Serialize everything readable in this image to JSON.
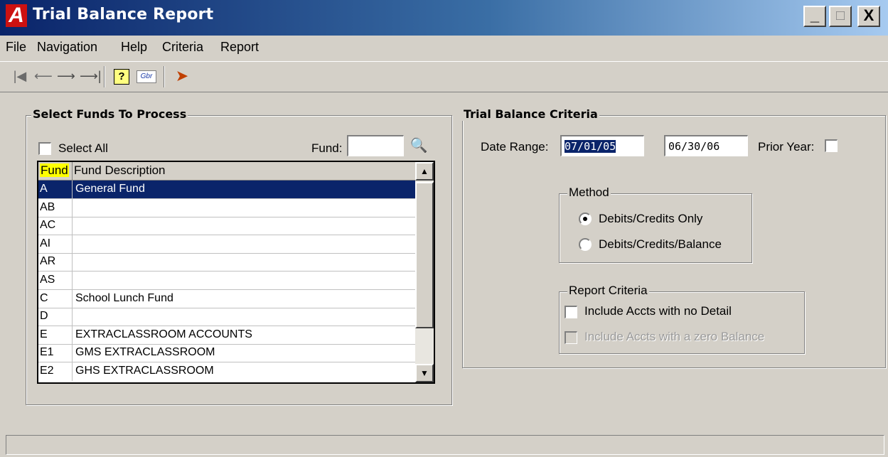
{
  "window": {
    "logo": "A",
    "title": "Trial Balance Report",
    "minimize": "_",
    "maximize": "□",
    "close": "X"
  },
  "menu": [
    "File",
    "Navigation",
    "Help",
    "Criteria",
    "Report"
  ],
  "toolbar": {
    "icons": [
      "first-record-icon",
      "previous-record-icon",
      "next-record-icon",
      "last-record-icon",
      "help-icon",
      "globe-icon",
      "run-icon"
    ]
  },
  "funds_panel": {
    "title": "Select Funds To Process",
    "select_all_label": "Select All",
    "fund_label": "Fund:",
    "fund_value": "",
    "columns": [
      "Fund",
      "Fund Description"
    ],
    "rows": [
      {
        "fund": "A",
        "description": "General Fund",
        "selected": true
      },
      {
        "fund": "AB",
        "description": ""
      },
      {
        "fund": "AC",
        "description": ""
      },
      {
        "fund": "AI",
        "description": ""
      },
      {
        "fund": "AR",
        "description": ""
      },
      {
        "fund": "AS",
        "description": ""
      },
      {
        "fund": "C",
        "description": "School Lunch Fund"
      },
      {
        "fund": "D",
        "description": ""
      },
      {
        "fund": "E",
        "description": "EXTRACLASSROOM ACCOUNTS"
      },
      {
        "fund": "E1",
        "description": "GMS EXTRACLASSROOM"
      },
      {
        "fund": "E2",
        "description": "GHS EXTRACLASSROOM"
      }
    ],
    "accent_color": "#ffff00"
  },
  "criteria_panel": {
    "title": "Trial Balance Criteria",
    "date_range_label": "Date Range:",
    "date_from": "07/01/05",
    "date_to": "06/30/06",
    "prior_year_label": "Prior Year:",
    "method": {
      "title": "Method",
      "options": [
        "Debits/Credits Only",
        "Debits/Credits/Balance"
      ],
      "selected": "Debits/Credits Only"
    },
    "report_criteria": {
      "title": "Report Criteria",
      "include_no_detail": "Include Accts with no Detail",
      "include_zero_balance": "Include Accts with a zero Balance"
    }
  },
  "status": ""
}
